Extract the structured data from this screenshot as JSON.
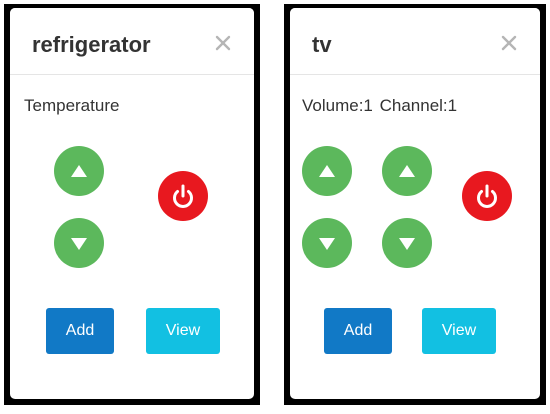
{
  "colors": {
    "accent_green": "#5cb85c",
    "power_red": "#e8181f",
    "add_blue": "#1179c6",
    "view_cyan": "#12c0e2"
  },
  "panels": [
    {
      "title": "refrigerator",
      "info_text": "Temperature",
      "controls": [
        {
          "icon": "triangle-up-icon"
        },
        {
          "icon": "triangle-down-icon"
        },
        {
          "icon": "power-icon"
        }
      ],
      "add_label": "Add",
      "view_label": "View"
    },
    {
      "title": "tv",
      "info_text": "Volume:1   Channel:1",
      "controls": [
        {
          "icon": "volume-up-icon"
        },
        {
          "icon": "volume-down-icon"
        },
        {
          "icon": "channel-up-icon"
        },
        {
          "icon": "channel-down-icon"
        },
        {
          "icon": "power-icon"
        }
      ],
      "add_label": "Add",
      "view_label": "View"
    }
  ]
}
